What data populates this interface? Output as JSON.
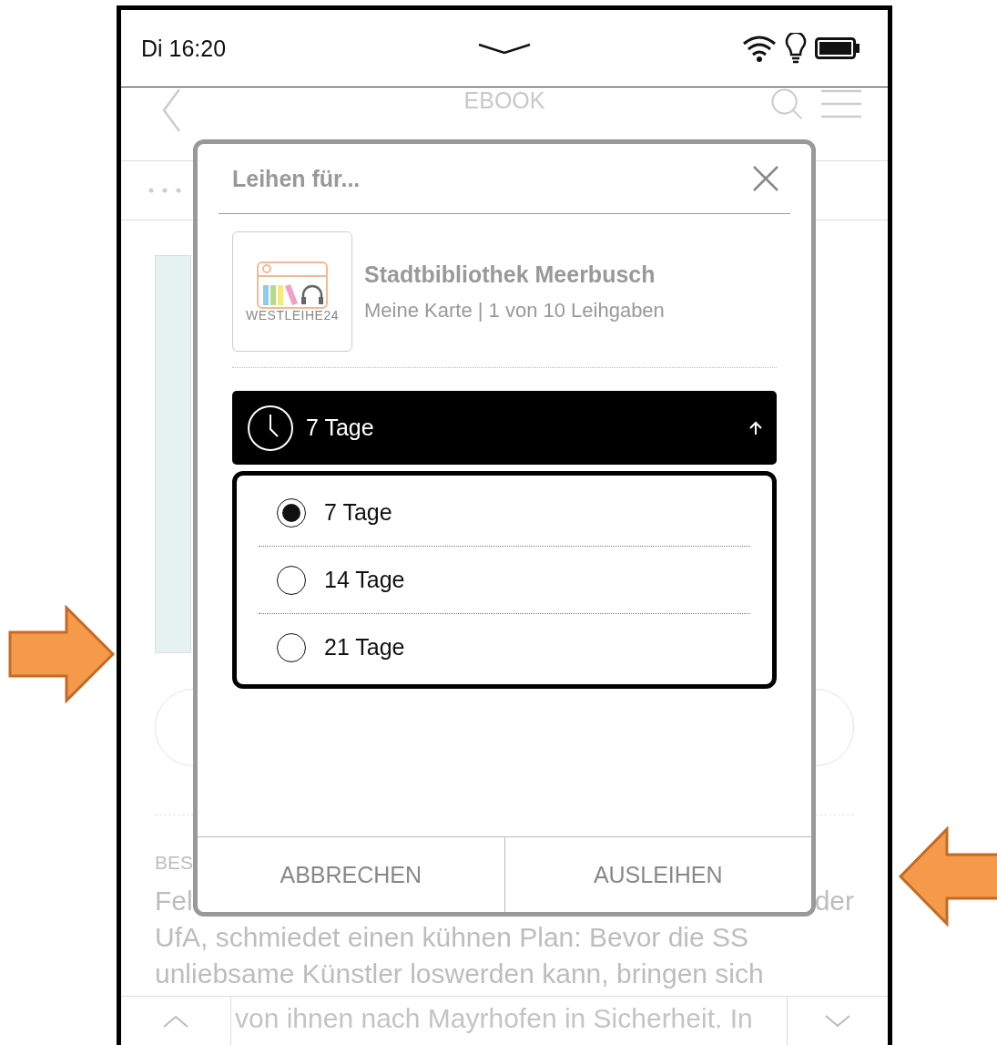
{
  "status_bar": {
    "time": "Di 16:20"
  },
  "header": {
    "title": "EBOOK"
  },
  "background": {
    "section_label": "BES",
    "first_line_start": "Fel",
    "first_line_end": "der",
    "lines": [
      "UfA, schmiedet einen kühnen Plan: Bevor die SS",
      "unliebsame Künstler loswerden kann, bringen sich"
    ],
    "last_line": "von ihnen nach Mayrhofen in Sicherheit. In"
  },
  "dialog": {
    "title": "Leihen für...",
    "library": {
      "logo_text": "WESTLEIHE24",
      "name": "Stadtbibliothek Meerbusch",
      "details": "Meine Karte | 1 von 10 Leihgaben"
    },
    "duration_select": {
      "value": "7 Tage",
      "expanded": true
    },
    "options": [
      {
        "label": "7 Tage",
        "selected": true
      },
      {
        "label": "14 Tage",
        "selected": false
      },
      {
        "label": "21 Tage",
        "selected": false
      }
    ],
    "buttons": [
      "ABBRECHEN",
      "AUSLEIHEN"
    ]
  }
}
